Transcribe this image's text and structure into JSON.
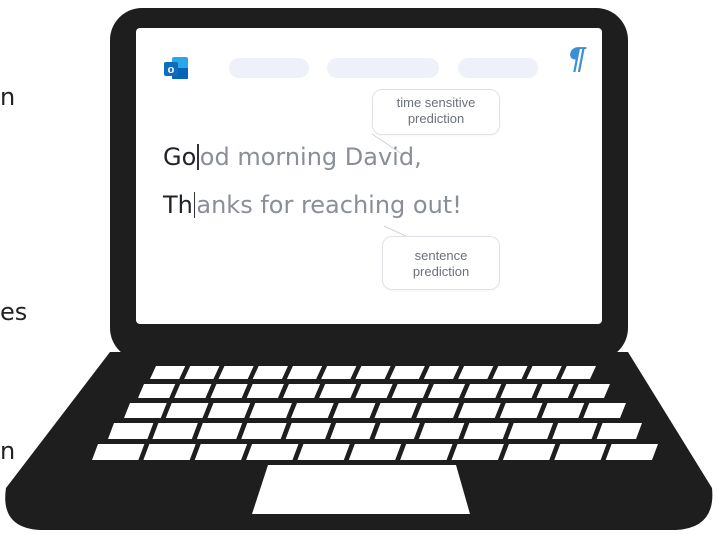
{
  "side_fragments": [
    "n",
    "es",
    "n"
  ],
  "screen": {
    "brand_icon": "outlook-icon",
    "brand_letter": "o",
    "format_icon": "pilcrow-icon",
    "format_glyph": "¶",
    "line1": {
      "typed": "Go",
      "predicted": "od morning David,"
    },
    "line2": {
      "typed": "Th",
      "predicted": "anks for reaching out!"
    },
    "bubble_time": [
      "time sensitive",
      "prediction"
    ],
    "bubble_sentence": [
      "sentence",
      "prediction"
    ]
  },
  "colors": {
    "accent": "#3b8fd4",
    "outlook_blue": "#0f6cbd",
    "laptop_body": "#1e1e1e"
  }
}
